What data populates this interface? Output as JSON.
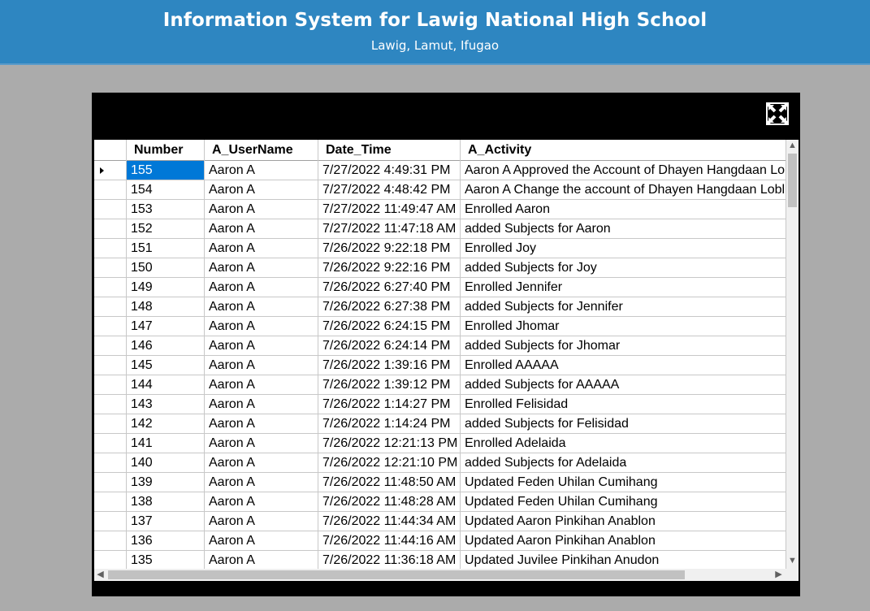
{
  "header": {
    "title": "Information System for Lawig National High School",
    "subtitle": "Lawig, Lamut, Ifugao"
  },
  "colors": {
    "header_bg": "#2e86c1",
    "selection": "#0078d7",
    "panel_bg": "#000000",
    "page_bg": "#ababab"
  },
  "close_button": {
    "icon": "close-icon"
  },
  "grid": {
    "columns": [
      "Number",
      "A_UserName",
      "Date_Time",
      "A_Activity"
    ],
    "selected_row": 0,
    "rows": [
      {
        "number": "155",
        "user": "Aaron A",
        "datetime": "7/27/2022 4:49:31 PM",
        "activity": "Aaron A Approved the Account of Dhayen Hangdaan Lo"
      },
      {
        "number": "154",
        "user": "Aaron A",
        "datetime": "7/27/2022 4:48:42 PM",
        "activity": "Aaron A Change the account of Dhayen Hangdaan Lobl"
      },
      {
        "number": "153",
        "user": "Aaron A",
        "datetime": "7/27/2022 11:49:47 AM",
        "activity": "Enrolled Aaron"
      },
      {
        "number": "152",
        "user": "Aaron A",
        "datetime": "7/27/2022 11:47:18 AM",
        "activity": "added Subjects for Aaron"
      },
      {
        "number": "151",
        "user": "Aaron A",
        "datetime": "7/26/2022 9:22:18 PM",
        "activity": "Enrolled Joy"
      },
      {
        "number": "150",
        "user": "Aaron A",
        "datetime": "7/26/2022 9:22:16 PM",
        "activity": "added Subjects for Joy"
      },
      {
        "number": "149",
        "user": "Aaron A",
        "datetime": "7/26/2022 6:27:40 PM",
        "activity": "Enrolled Jennifer"
      },
      {
        "number": "148",
        "user": "Aaron A",
        "datetime": "7/26/2022 6:27:38 PM",
        "activity": "added Subjects for Jennifer"
      },
      {
        "number": "147",
        "user": "Aaron A",
        "datetime": "7/26/2022 6:24:15 PM",
        "activity": "Enrolled Jhomar"
      },
      {
        "number": "146",
        "user": "Aaron A",
        "datetime": "7/26/2022 6:24:14 PM",
        "activity": "added Subjects for Jhomar"
      },
      {
        "number": "145",
        "user": "Aaron A",
        "datetime": "7/26/2022 1:39:16 PM",
        "activity": "Enrolled AAAAA"
      },
      {
        "number": "144",
        "user": "Aaron A",
        "datetime": "7/26/2022 1:39:12 PM",
        "activity": "added Subjects for AAAAA"
      },
      {
        "number": "143",
        "user": "Aaron A",
        "datetime": "7/26/2022 1:14:27 PM",
        "activity": "Enrolled Felisidad"
      },
      {
        "number": "142",
        "user": "Aaron A",
        "datetime": "7/26/2022 1:14:24 PM",
        "activity": "added Subjects for Felisidad"
      },
      {
        "number": "141",
        "user": "Aaron A",
        "datetime": "7/26/2022 12:21:13 PM",
        "activity": "Enrolled Adelaida"
      },
      {
        "number": "140",
        "user": "Aaron A",
        "datetime": "7/26/2022 12:21:10 PM",
        "activity": "added Subjects for Adelaida"
      },
      {
        "number": "139",
        "user": "Aaron A",
        "datetime": "7/26/2022 11:48:50 AM",
        "activity": "Updated Feden Uhilan Cumihang"
      },
      {
        "number": "138",
        "user": "Aaron A",
        "datetime": "7/26/2022 11:48:28 AM",
        "activity": "Updated Feden Uhilan Cumihang"
      },
      {
        "number": "137",
        "user": "Aaron A",
        "datetime": "7/26/2022 11:44:34 AM",
        "activity": "Updated Aaron Pinkihan Anablon"
      },
      {
        "number": "136",
        "user": "Aaron A",
        "datetime": "7/26/2022 11:44:16 AM",
        "activity": "Updated Aaron Pinkihan Anablon"
      },
      {
        "number": "135",
        "user": "Aaron A",
        "datetime": "7/26/2022 11:36:18 AM",
        "activity": "Updated Juvilee Pinkihan Anudon"
      }
    ]
  }
}
